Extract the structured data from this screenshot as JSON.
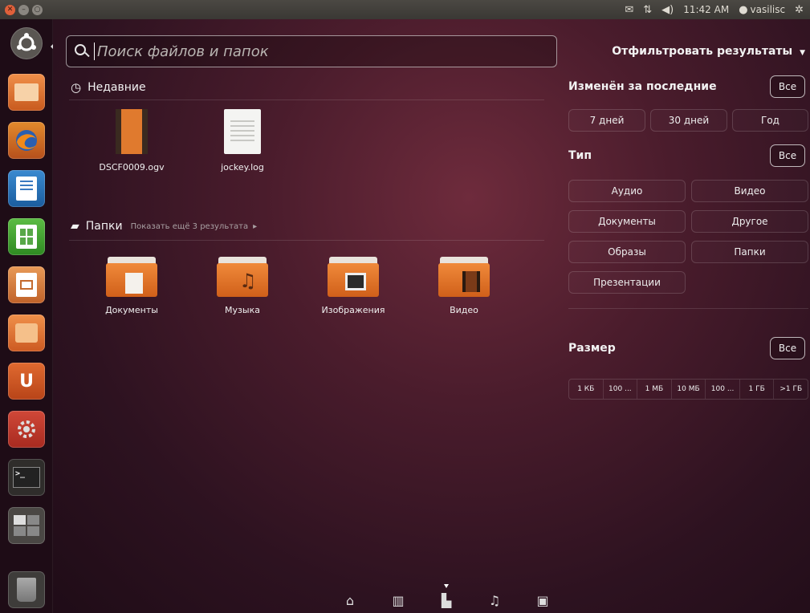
{
  "topbar": {
    "time": "11:42 AM",
    "user": "vasilisc",
    "icons": [
      "mail-icon",
      "network-icon",
      "volume-icon",
      "user-icon",
      "gear-icon"
    ]
  },
  "launcher": {
    "items": [
      "dash-home",
      "files",
      "firefox",
      "writer",
      "calc",
      "impress",
      "software-center",
      "ubuntu-one",
      "system-settings",
      "terminal",
      "workspace-switcher",
      "trash"
    ]
  },
  "search": {
    "placeholder": "Поиск файлов и папок"
  },
  "recent": {
    "title": "Недавние",
    "items": [
      {
        "label": "DSCF0009.ogv",
        "icon": "video-file-icon"
      },
      {
        "label": "jockey.log",
        "icon": "text-file-icon"
      }
    ]
  },
  "folders": {
    "title": "Папки",
    "more": "Показать ещё 3 результата",
    "items": [
      {
        "label": "Документы",
        "icon": "documents-folder-icon"
      },
      {
        "label": "Музыка",
        "icon": "music-folder-icon"
      },
      {
        "label": "Изображения",
        "icon": "pictures-folder-icon"
      },
      {
        "label": "Видео",
        "icon": "videos-folder-icon"
      }
    ]
  },
  "filters": {
    "title": "Отфильтровать результаты",
    "modified": {
      "title": "Изменён за последние",
      "all": "Все",
      "options": [
        "7 дней",
        "30 дней",
        "Год"
      ]
    },
    "type": {
      "title": "Тип",
      "all": "Все",
      "options": [
        "Аудио",
        "Видео",
        "Документы",
        "Другое",
        "Образы",
        "Папки",
        "Презентации"
      ]
    },
    "size": {
      "title": "Размер",
      "all": "Все",
      "options": [
        "1 КБ",
        "100 ...",
        "1 МБ",
        "10 МБ",
        "100 ...",
        "1 ГБ",
        ">1 ГБ"
      ]
    }
  },
  "lenses": [
    "home-lens-icon",
    "applications-lens-icon",
    "files-lens-icon",
    "music-lens-icon",
    "video-lens-icon"
  ]
}
